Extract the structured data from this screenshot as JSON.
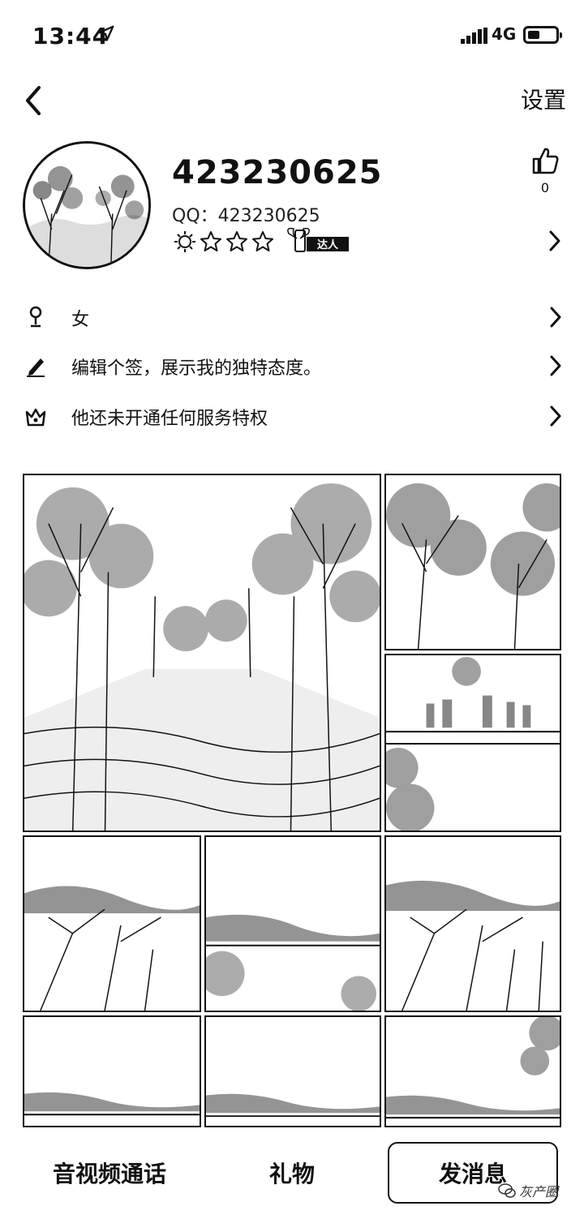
{
  "status_bar": {
    "time": "13:44",
    "network": "4G"
  },
  "nav": {
    "settings_label": "设置"
  },
  "profile": {
    "nickname": "423230625",
    "qq_line": "QQ：423230625",
    "like_count": "0",
    "level_stars": 4,
    "badge_text": "达人"
  },
  "info_rows": [
    {
      "icon": "person-icon",
      "text": "女"
    },
    {
      "icon": "pencil-icon",
      "text": "编辑个签，展示我的独特态度。"
    },
    {
      "icon": "crown-icon",
      "text": "他还未开通任何服务特权"
    }
  ],
  "bottom_bar": {
    "call_label": "音视频通话",
    "gift_label": "礼物",
    "message_label": "发消息"
  },
  "watermark": {
    "text": "灰产圈"
  }
}
